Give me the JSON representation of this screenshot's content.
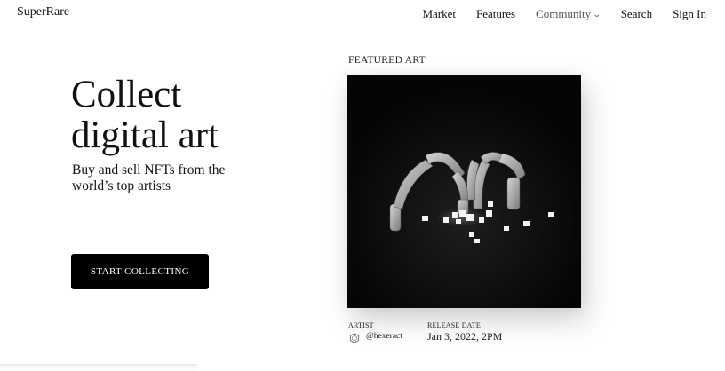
{
  "header": {
    "logo": "SuperRare",
    "nav": [
      {
        "label": "Market"
      },
      {
        "label": "Features"
      },
      {
        "label": "Community"
      },
      {
        "label": "Search"
      },
      {
        "label": "Sign In"
      }
    ]
  },
  "hero": {
    "title_line1": "Collect",
    "title_line2": "digital art",
    "subtitle": "Buy and sell NFTs from the world’s top artists",
    "cta_label": "START COLLECTING"
  },
  "featured": {
    "label": "FEATURED ART",
    "artist_label": "ARTIST",
    "artist_name": "@hexeract",
    "release_label": "RELEASE DATE",
    "release_date": "Jan 3, 2022, 2PM",
    "artist_icon": "hexagon-avatar-icon",
    "dropdown_icon": "chevron-down-icon"
  }
}
